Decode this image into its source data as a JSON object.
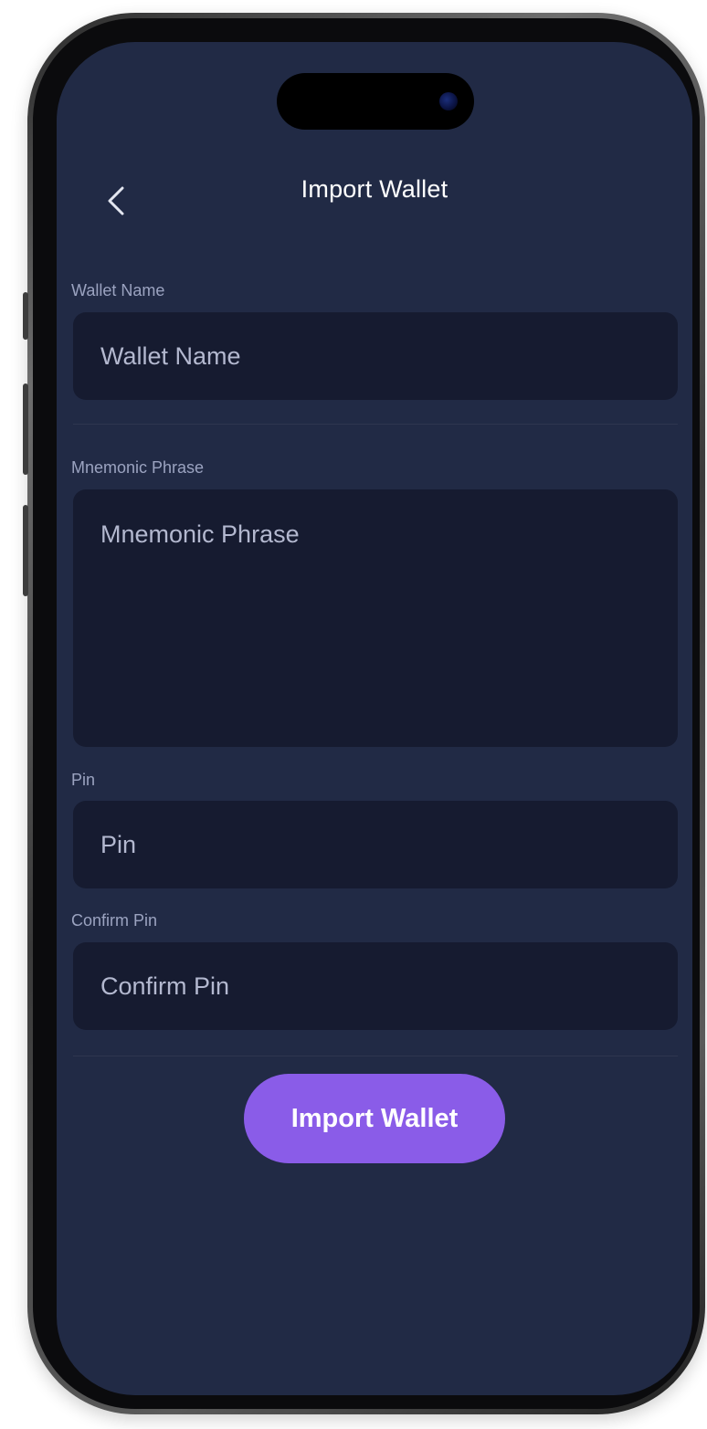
{
  "header": {
    "title": "Import Wallet",
    "back_icon": "chevron-left-icon"
  },
  "form": {
    "wallet_name": {
      "label": "Wallet Name",
      "placeholder": "Wallet Name",
      "value": ""
    },
    "mnemonic": {
      "label": "Mnemonic Phrase",
      "placeholder": "Mnemonic Phrase",
      "value": ""
    },
    "pin": {
      "label": "Pin",
      "placeholder": "Pin",
      "value": ""
    },
    "confirm_pin": {
      "label": "Confirm Pin",
      "placeholder": "Confirm Pin",
      "value": ""
    }
  },
  "actions": {
    "import_label": "Import Wallet"
  },
  "colors": {
    "screen_background": "#212a45",
    "field_background": "#161b30",
    "accent": "#8a5ce8",
    "label_text": "#9ba3c0",
    "title_text": "#ffffff"
  }
}
